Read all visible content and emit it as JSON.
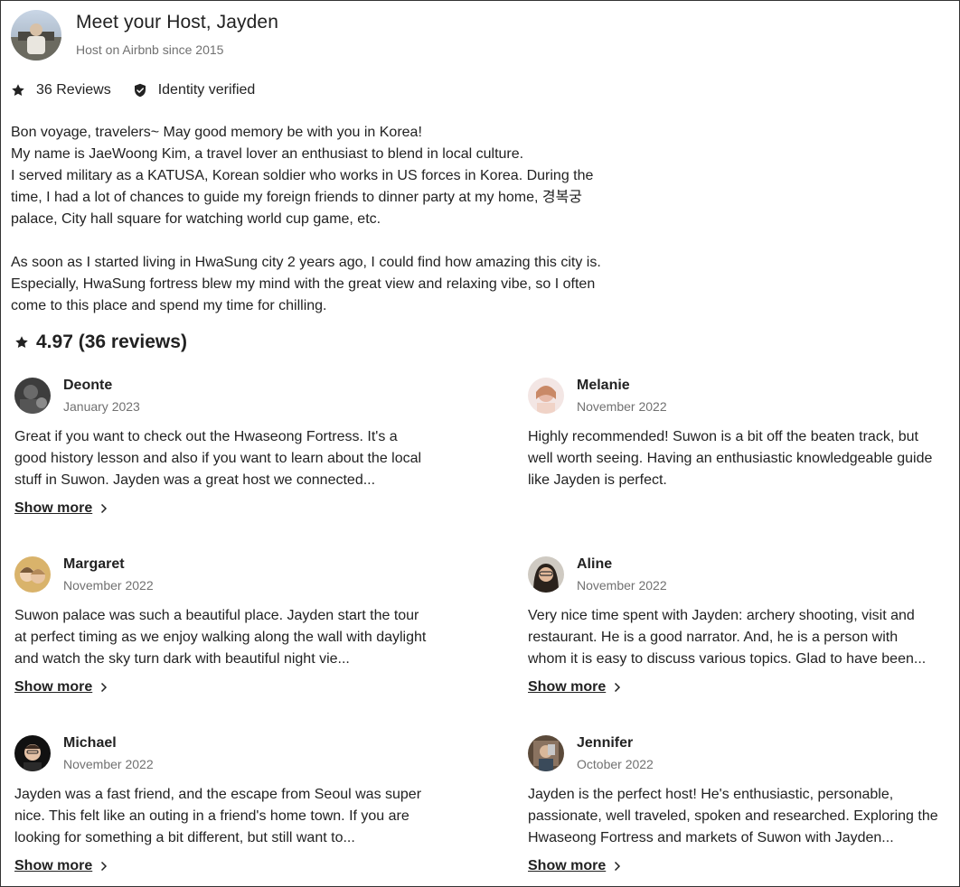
{
  "host": {
    "title": "Meet your Host, Jayden",
    "since": "Host on Airbnb since 2015",
    "reviews_badge": "36 Reviews",
    "identity_badge": "Identity verified",
    "about": {
      "p1_l1": "Bon voyage, travelers~ May good memory be with you in Korea!",
      "p1_l2": "My name is JaeWoong Kim, a travel lover an enthusiast to blend in local culture.",
      "p1_l3": "I served military as a KATUSA, Korean soldier who works in US forces in Korea. During the time, I had a lot of chances to guide my foreign friends to dinner party at my home, 경복궁 palace, City hall square for watching world cup game, etc.",
      "p2": "As soon as I started living in HwaSung city 2 years ago, I could find how amazing this city is. Especially, HwaSung fortress blew my mind with the great view and relaxing vibe, so I often come to this place and spend my time for chilling."
    }
  },
  "rating": {
    "label": "4.97 (36 reviews)"
  },
  "show_more_label": "Show more",
  "icons": {
    "star": "star-icon",
    "shield": "shield-check-icon",
    "chevron": "chevron-right-icon"
  },
  "reviews": [
    {
      "name": "Deonte",
      "date": "January 2023",
      "text": "Great if you want to check out the Hwaseong Fortress. It's a good history lesson and also if you want to learn about the local stuff in Suwon. Jayden was a great host we connected...",
      "show_more": true
    },
    {
      "name": "Melanie",
      "date": "November 2022",
      "text": "Highly recommended! Suwon is a bit off the beaten track, but well worth seeing. Having an enthusiastic knowledgeable guide like Jayden is perfect.",
      "show_more": false
    },
    {
      "name": "Margaret",
      "date": "November 2022",
      "text": "Suwon palace was such a beautiful place. Jayden start the tour at perfect timing as we enjoy walking along the wall with daylight and watch the sky turn dark with beautiful night vie...",
      "show_more": true
    },
    {
      "name": "Aline",
      "date": "November 2022",
      "text": "Very nice time spent with Jayden: archery shooting, visit and restaurant. He is a good narrator. And, he is a person with whom it is easy to discuss various topics. Glad to have been...",
      "show_more": true
    },
    {
      "name": "Michael",
      "date": "November 2022",
      "text": "Jayden was a fast friend, and the escape from Seoul was super nice. This felt like an outing in a friend's home town. If you are looking for something a bit different, but still want to...",
      "show_more": true
    },
    {
      "name": "Jennifer",
      "date": "October 2022",
      "text": "Jayden is the perfect host! He's enthusiastic, personable, passionate, well traveled, spoken and researched. Exploring the Hwaseong Fortress and markets of Suwon with Jayden...",
      "show_more": true
    }
  ]
}
